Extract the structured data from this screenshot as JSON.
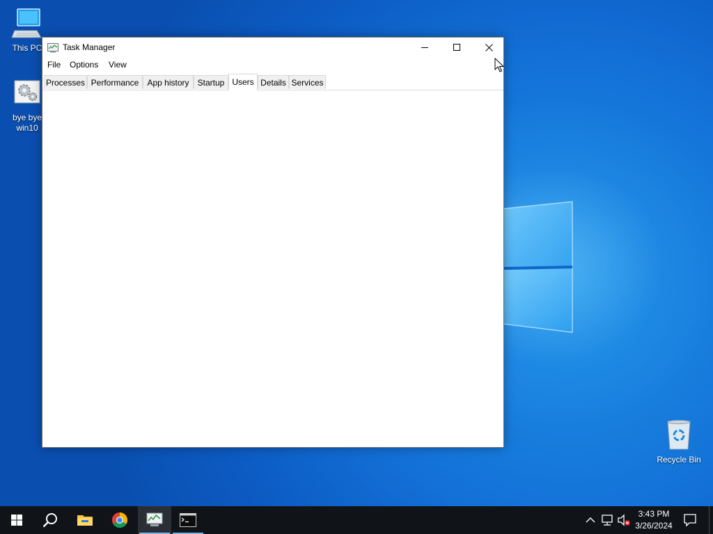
{
  "desktop": {
    "icons": [
      {
        "label": "This PC"
      },
      {
        "label": "bye bye win10"
      },
      {
        "label": "Recycle Bin"
      }
    ]
  },
  "window": {
    "title": "Task Manager",
    "menu": [
      "File",
      "Options",
      "View"
    ],
    "tabs": [
      "Processes",
      "Performance",
      "App history",
      "Startup",
      "Users",
      "Details",
      "Services"
    ],
    "active_tab": "Users"
  },
  "taskbar": {
    "apps": [
      "start-icon",
      "search-icon",
      "file-explorer-icon",
      "chrome-icon",
      "task-manager-icon",
      "command-prompt-icon"
    ],
    "clock": {
      "time": "3:43 PM",
      "date": "3/26/2024"
    }
  },
  "colors": {
    "desktop_blue": "#1473d8",
    "taskbar": "#101418",
    "running_indicator": "#76b9ed"
  }
}
